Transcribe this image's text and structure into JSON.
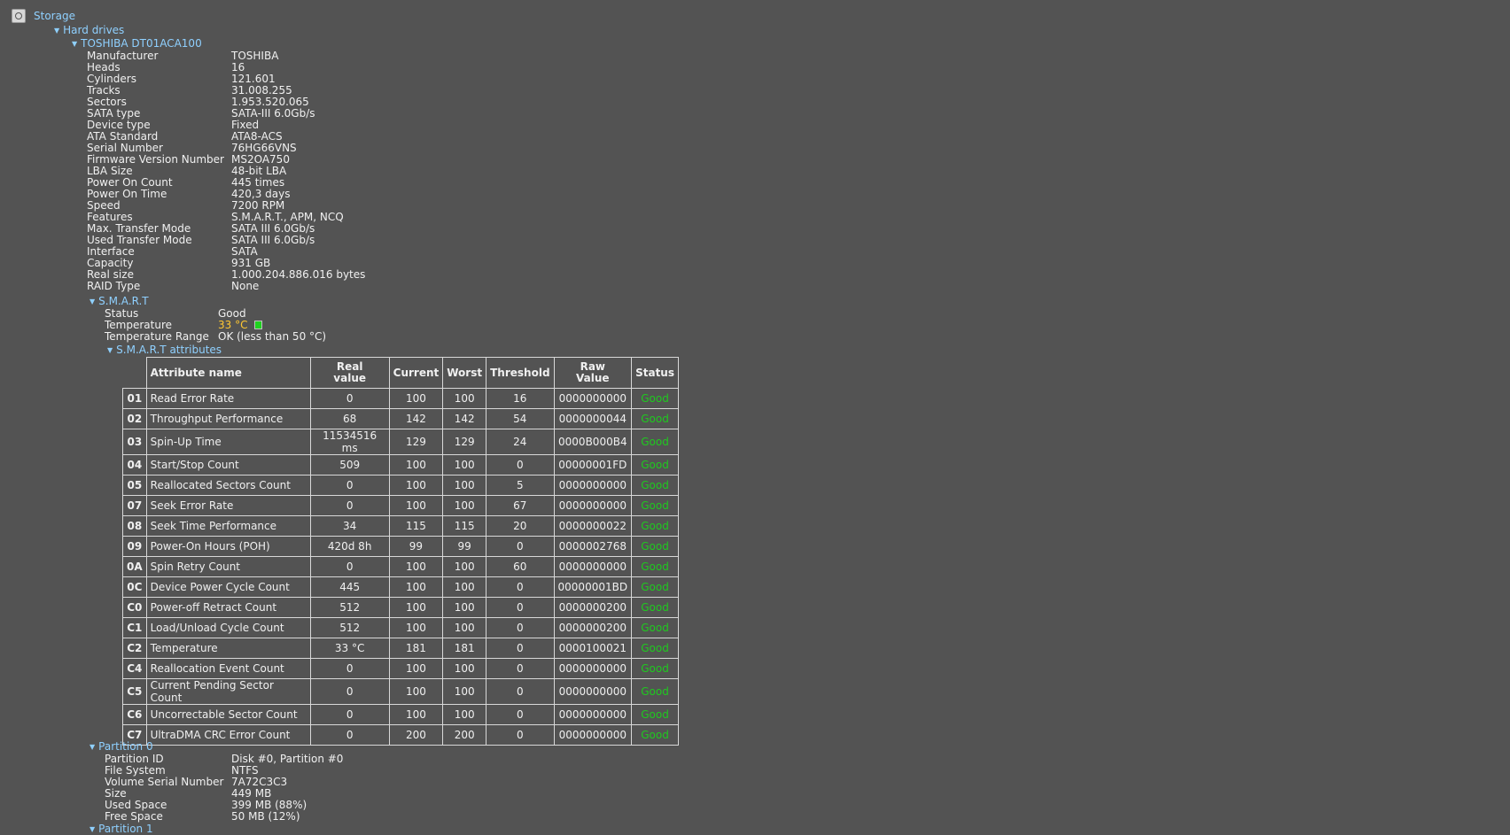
{
  "tree": {
    "storage_label": "Storage",
    "hard_drives_label": "Hard drives",
    "drive_name": "TOSHIBA DT01ACA100",
    "smart_label": "S.M.A.R.T",
    "smart_attributes_label": "S.M.A.R.T attributes",
    "partition0_label": "Partition 0",
    "partition1_label": "Partition 1"
  },
  "drive_props": [
    {
      "label": "Manufacturer",
      "value": "TOSHIBA"
    },
    {
      "label": "Heads",
      "value": "16"
    },
    {
      "label": "Cylinders",
      "value": "121.601"
    },
    {
      "label": "Tracks",
      "value": "31.008.255"
    },
    {
      "label": "Sectors",
      "value": "1.953.520.065"
    },
    {
      "label": "SATA type",
      "value": "SATA-III 6.0Gb/s"
    },
    {
      "label": "Device type",
      "value": "Fixed"
    },
    {
      "label": "ATA Standard",
      "value": "ATA8-ACS"
    },
    {
      "label": "Serial Number",
      "value": "76HG66VNS"
    },
    {
      "label": "Firmware Version Number",
      "value": "MS2OA750"
    },
    {
      "label": "LBA Size",
      "value": "48-bit LBA"
    },
    {
      "label": "Power On Count",
      "value": "445 times"
    },
    {
      "label": "Power On Time",
      "value": "420,3 days"
    },
    {
      "label": "Speed",
      "value": "7200 RPM"
    },
    {
      "label": "Features",
      "value": "S.M.A.R.T., APM, NCQ"
    },
    {
      "label": "Max. Transfer Mode",
      "value": "SATA III 6.0Gb/s"
    },
    {
      "label": "Used Transfer Mode",
      "value": "SATA III 6.0Gb/s"
    },
    {
      "label": "Interface",
      "value": "SATA"
    },
    {
      "label": "Capacity",
      "value": "931 GB"
    },
    {
      "label": "Real size",
      "value": "1.000.204.886.016 bytes"
    },
    {
      "label": "RAID Type",
      "value": "None"
    }
  ],
  "smart": {
    "status_label": "Status",
    "status_value": "Good",
    "temperature_label": "Temperature",
    "temperature_value": "33 °C",
    "temp_range_label": "Temperature Range",
    "temp_range_value": "OK (less than 50 °C)"
  },
  "smart_table": {
    "headers": [
      "Attribute name",
      "Real value",
      "Current",
      "Worst",
      "Threshold",
      "Raw Value",
      "Status"
    ],
    "rows": [
      [
        "01",
        "Read Error Rate",
        "0",
        "100",
        "100",
        "16",
        "0000000000",
        "Good"
      ],
      [
        "02",
        "Throughput Performance",
        "68",
        "142",
        "142",
        "54",
        "0000000044",
        "Good"
      ],
      [
        "03",
        "Spin-Up Time",
        "11534516 ms",
        "129",
        "129",
        "24",
        "0000B000B4",
        "Good"
      ],
      [
        "04",
        "Start/Stop Count",
        "509",
        "100",
        "100",
        "0",
        "00000001FD",
        "Good"
      ],
      [
        "05",
        "Reallocated Sectors Count",
        "0",
        "100",
        "100",
        "5",
        "0000000000",
        "Good"
      ],
      [
        "07",
        "Seek Error Rate",
        "0",
        "100",
        "100",
        "67",
        "0000000000",
        "Good"
      ],
      [
        "08",
        "Seek Time Performance",
        "34",
        "115",
        "115",
        "20",
        "0000000022",
        "Good"
      ],
      [
        "09",
        "Power-On Hours (POH)",
        "420d 8h",
        "99",
        "99",
        "0",
        "0000002768",
        "Good"
      ],
      [
        "0A",
        "Spin Retry Count",
        "0",
        "100",
        "100",
        "60",
        "0000000000",
        "Good"
      ],
      [
        "0C",
        "Device Power Cycle Count",
        "445",
        "100",
        "100",
        "0",
        "00000001BD",
        "Good"
      ],
      [
        "C0",
        "Power-off Retract Count",
        "512",
        "100",
        "100",
        "0",
        "0000000200",
        "Good"
      ],
      [
        "C1",
        "Load/Unload Cycle Count",
        "512",
        "100",
        "100",
        "0",
        "0000000200",
        "Good"
      ],
      [
        "C2",
        "Temperature",
        "33 °C",
        "181",
        "181",
        "0",
        "0000100021",
        "Good"
      ],
      [
        "C4",
        "Reallocation Event Count",
        "0",
        "100",
        "100",
        "0",
        "0000000000",
        "Good"
      ],
      [
        "C5",
        "Current Pending Sector Count",
        "0",
        "100",
        "100",
        "0",
        "0000000000",
        "Good"
      ],
      [
        "C6",
        "Uncorrectable Sector Count",
        "0",
        "100",
        "100",
        "0",
        "0000000000",
        "Good"
      ],
      [
        "C7",
        "UltraDMA CRC Error Count",
        "0",
        "200",
        "200",
        "0",
        "0000000000",
        "Good"
      ]
    ]
  },
  "partition0": [
    {
      "label": "Partition ID",
      "value": "Disk #0, Partition #0"
    },
    {
      "label": "File System",
      "value": "NTFS"
    },
    {
      "label": "Volume Serial Number",
      "value": "7A72C3C3"
    },
    {
      "label": "Size",
      "value": "449 MB"
    },
    {
      "label": "Used Space",
      "value": "399 MB (88%)"
    },
    {
      "label": "Free Space",
      "value": "50 MB (12%)"
    }
  ],
  "colors": {
    "background": "#535353",
    "link": "#8fd0ff",
    "good": "#1fc91f",
    "temperature": "#ffc832"
  }
}
